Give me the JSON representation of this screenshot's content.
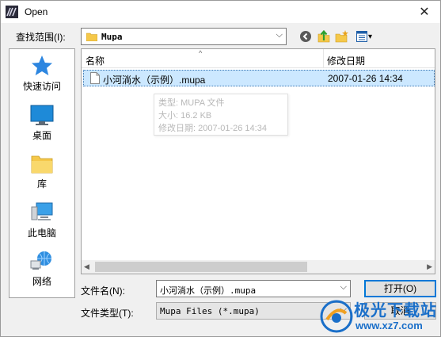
{
  "window": {
    "title": "Open",
    "close_glyph": "✕"
  },
  "lookin": {
    "label": "查找范围(I):",
    "value": "Mupa",
    "dropdown_glyph": "⌵",
    "view_menu_glyph": "▾"
  },
  "places": [
    {
      "label": "快速访问",
      "icon": "star-icon"
    },
    {
      "label": "桌面",
      "icon": "desktop-icon"
    },
    {
      "label": "库",
      "icon": "library-icon"
    },
    {
      "label": "此电脑",
      "icon": "computer-icon"
    },
    {
      "label": "网络",
      "icon": "network-icon"
    }
  ],
  "filelist": {
    "col_name": "名称",
    "col_date": "修改日期",
    "sort_glyph": "^",
    "rows": [
      {
        "name": "小河淌水（示例）.mupa",
        "date": "2007-01-26 14:34"
      }
    ],
    "tooltip": {
      "type": "类型: MUPA 文件",
      "size": "大小: 16.2 KB",
      "modified": "修改日期: 2007-01-26 14:34"
    },
    "scroll_left_glyph": "◀",
    "scroll_right_glyph": "▶"
  },
  "filename": {
    "label": "文件名(N):",
    "value": "小河淌水（示例）.mupa",
    "dropdown_glyph": "⌵"
  },
  "filetype": {
    "label": "文件类型(T):",
    "value": "Mupa Files (*.mupa)",
    "dropdown_glyph": "⌵"
  },
  "buttons": {
    "open": "打开(O)",
    "cancel": "取消"
  },
  "watermark": {
    "brand": "极光下载站",
    "url": "www.xz7.com"
  },
  "colors": {
    "selection": "#cce8ff",
    "accent": "#0078d7",
    "watermark": "#1a6fc9"
  }
}
